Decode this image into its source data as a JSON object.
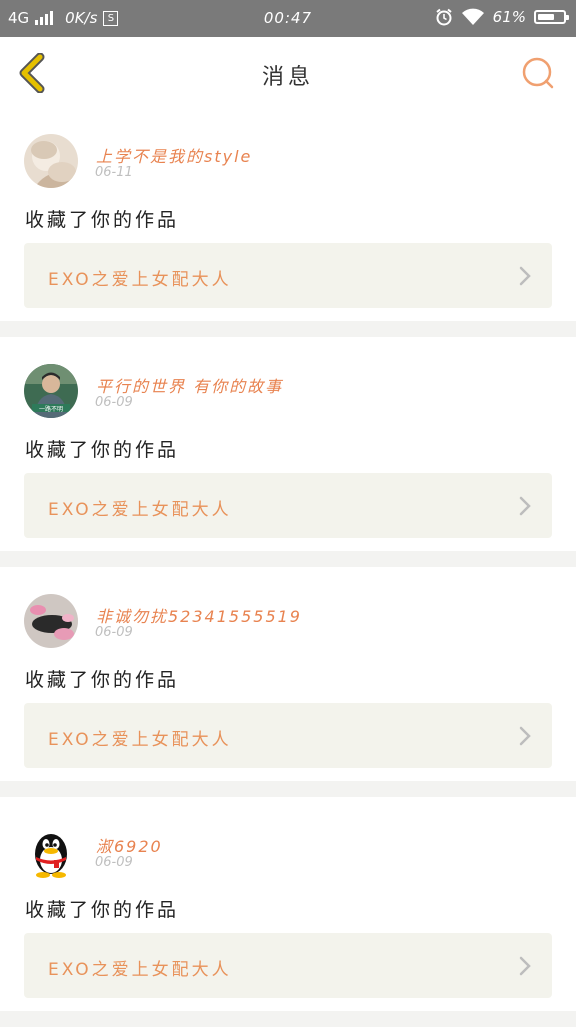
{
  "status": {
    "network": "4G",
    "speed": "0K/s",
    "s_icon": "S",
    "time": "00:47",
    "battery": "61%",
    "battery_level": 0.61
  },
  "header": {
    "title": "消息"
  },
  "colors": {
    "accent": "#e88350",
    "back_arrow": "#e5c000",
    "work_box_bg": "#f3f3ec"
  },
  "notifications": [
    {
      "user": "上学不是我的style",
      "date": "06-11",
      "action": "收藏了你的作品",
      "work": "EXO之爱上女配大人",
      "avatar_icon": "girl-photo-avatar"
    },
    {
      "user": "平行的世界 有你的故事",
      "date": "06-09",
      "action": "收藏了你的作品",
      "work": "EXO之爱上女配大人",
      "avatar_icon": "boy-photo-avatar"
    },
    {
      "user": "非诚勿扰52341555519",
      "date": "06-09",
      "action": "收藏了你的作品",
      "work": "EXO之爱上女配大人",
      "avatar_icon": "flower-photo-avatar"
    },
    {
      "user": "淑6920",
      "date": "06-09",
      "action": "收藏了你的作品",
      "work": "EXO之爱上女配大人",
      "avatar_icon": "penguin-avatar"
    }
  ]
}
